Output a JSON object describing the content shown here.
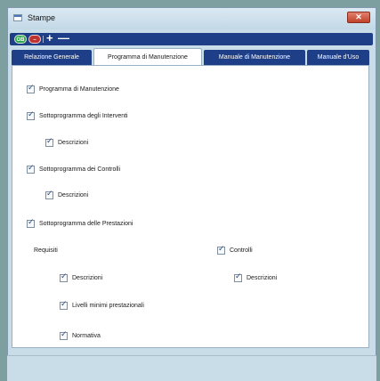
{
  "window": {
    "title": "Stampe",
    "close_glyph": "✕"
  },
  "toolbar": {
    "green_label": "GB",
    "red_label": "–",
    "plus_glyph": "+",
    "minus_glyph": "—"
  },
  "tabs": [
    {
      "label": "Relazione Generale",
      "active": false
    },
    {
      "label": "Programma di Manutenzione",
      "active": true
    },
    {
      "label": "Manuale di Manutenzione",
      "active": false
    },
    {
      "label": "Manuale d'Uso",
      "active": false
    }
  ],
  "options": {
    "programma": {
      "label": "Programma di Manutenzione",
      "checked": true
    },
    "interventi": {
      "label": "Sottoprogramma degli Interventi",
      "checked": true
    },
    "interventi_descrizioni": {
      "label": "Descrizioni",
      "checked": true
    },
    "controlli": {
      "label": "Sottoprogramma dei Controlli",
      "checked": true
    },
    "controlli_descrizioni": {
      "label": "Descrizioni",
      "checked": true
    },
    "prestazioni": {
      "label": "Sottoprogramma delle Prestazioni",
      "checked": true
    },
    "requisiti_heading": "Requisiti",
    "requisiti_descrizioni": {
      "label": "Descrizioni",
      "checked": true
    },
    "livelli_minimi": {
      "label": "Livelli minimi prestazionali",
      "checked": true
    },
    "normativa": {
      "label": "Normativa",
      "checked": true
    },
    "controlli_group": {
      "label": "Controlli",
      "checked": true
    },
    "controlli_group_descrizioni": {
      "label": "Descrizioni",
      "checked": true
    }
  },
  "colors": {
    "toolbar_bg": "#1e3f87",
    "tab_bg": "#1e3f87",
    "panel_bg": "#ffffff",
    "window_bg": "#c9dde8",
    "desktop_bg": "#7e9fa0"
  }
}
